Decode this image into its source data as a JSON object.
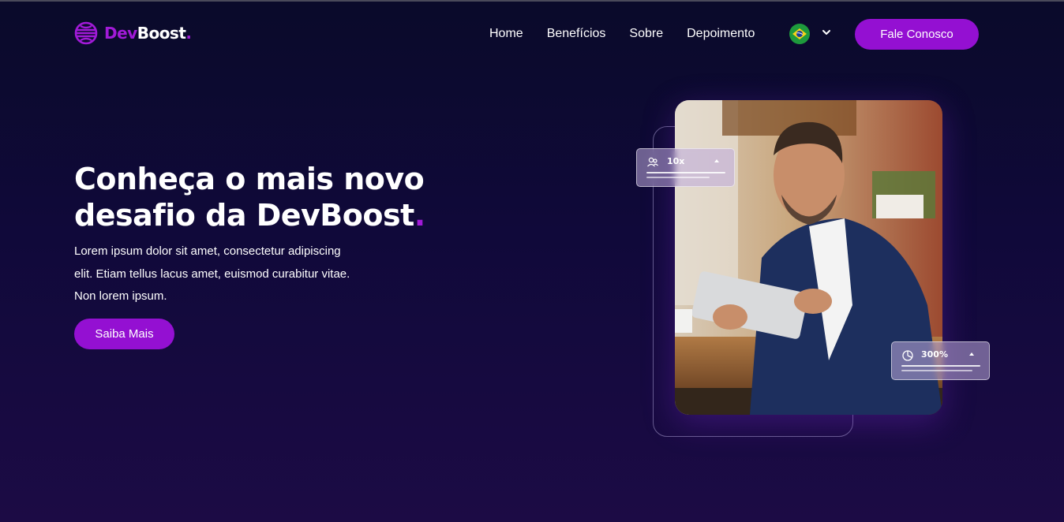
{
  "brand": {
    "dev": "Dev",
    "boost": "Boost",
    "dot": "."
  },
  "nav": {
    "items": [
      {
        "label": "Home"
      },
      {
        "label": "Benefícios"
      },
      {
        "label": "Sobre"
      },
      {
        "label": "Depoimento"
      }
    ],
    "language_icon": "brazil-flag-icon",
    "contact_label": "Fale Conosco"
  },
  "hero": {
    "title_line1": "Conheça o mais novo",
    "title_line2": "desafio da DevBoost",
    "title_dot": ".",
    "text": "Lorem ipsum dolor sit amet, consectetur adipiscing elit. Etiam tellus lacus amet, euismod curabitur vitae. Non lorem ipsum.",
    "button_label": "Saiba Mais"
  },
  "stats": [
    {
      "icon": "users-icon",
      "value": "10x"
    },
    {
      "icon": "pie-chart-icon",
      "value": "300%"
    }
  ],
  "colors": {
    "accent": "#9410d2",
    "brand_purple": "#a21ad8",
    "background": "#10093a"
  }
}
